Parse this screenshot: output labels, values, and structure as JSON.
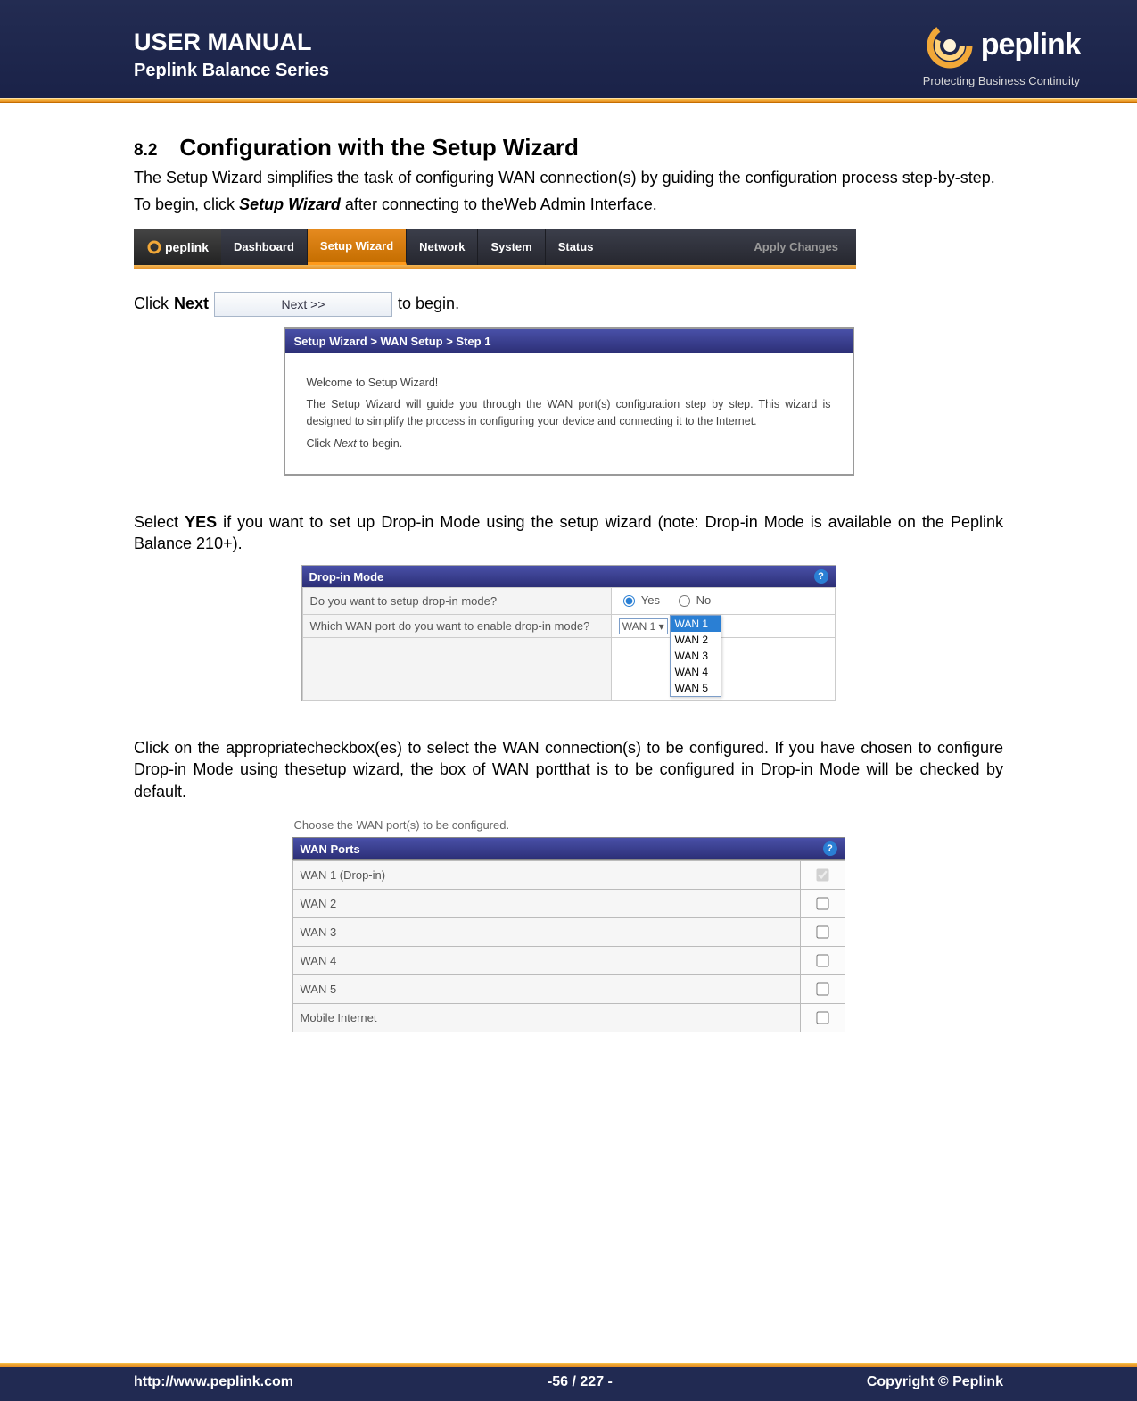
{
  "header": {
    "title": "USER MANUAL",
    "subtitle": "Peplink Balance Series",
    "logo_text": "peplink",
    "tagline": "Protecting Business Continuity"
  },
  "section": {
    "number": "8.2",
    "title": "Configuration with the Setup Wizard"
  },
  "para1": "The Setup Wizard simplifies the task of configuring WAN connection(s) by guiding the configuration process step-by-step.",
  "para2_pre": "To begin, click ",
  "para2_bold": "Setup Wizard",
  "para2_post": " after connecting to theWeb Admin Interface.",
  "nav": {
    "logo": "peplink",
    "tabs": [
      "Dashboard",
      "Setup Wizard",
      "Network",
      "System",
      "Status"
    ],
    "active_index": 1,
    "apply": "Apply Changes"
  },
  "next_line": {
    "pre": "Click ",
    "bold": "Next",
    "button": "Next >>",
    "post": "to begin."
  },
  "step1": {
    "title": "Setup Wizard > WAN Setup > Step 1",
    "l1": "Welcome to Setup Wizard!",
    "l2": "The Setup Wizard will guide you through the WAN port(s) configuration step by step. This wizard is designed to simplify the process in configuring your device and connecting it to the Internet.",
    "l3_pre": "Click ",
    "l3_i": "Next",
    "l3_post": " to begin."
  },
  "para3_pre": "Select ",
  "para3_bold": "YES",
  "para3_post": " if you want to set up Drop-in Mode using the setup wizard (note: Drop-in Mode is available on the Peplink Balance 210+).",
  "dropin": {
    "header": "Drop-in Mode",
    "q1": "Do you want to setup drop-in mode?",
    "yes": "Yes",
    "no": "No",
    "q2": "Which WAN port do you want to enable drop-in mode?",
    "selected": "WAN 1",
    "options": [
      "WAN 1",
      "WAN 2",
      "WAN 3",
      "WAN 4",
      "WAN 5"
    ]
  },
  "para4": "Click on the appropriatecheckbox(es) to select the WAN connection(s) to be configured. If you have chosen to configure Drop-in Mode using thesetup wizard, the box of WAN portthat is to be configured in Drop-in Mode will be checked by default.",
  "wanports": {
    "caption": "Choose the WAN port(s) to be configured.",
    "header": "WAN Ports",
    "rows": [
      {
        "label": "WAN 1 (Drop-in)",
        "checked": true,
        "disabled": true
      },
      {
        "label": "WAN 2",
        "checked": false,
        "disabled": false
      },
      {
        "label": "WAN 3",
        "checked": false,
        "disabled": false
      },
      {
        "label": "WAN 4",
        "checked": false,
        "disabled": false
      },
      {
        "label": "WAN 5",
        "checked": false,
        "disabled": false
      },
      {
        "label": "Mobile Internet",
        "checked": false,
        "disabled": false
      }
    ]
  },
  "footer": {
    "url": "http://www.peplink.com",
    "page": "-56 / 227 -",
    "copyright": "Copyright ©  Peplink"
  }
}
